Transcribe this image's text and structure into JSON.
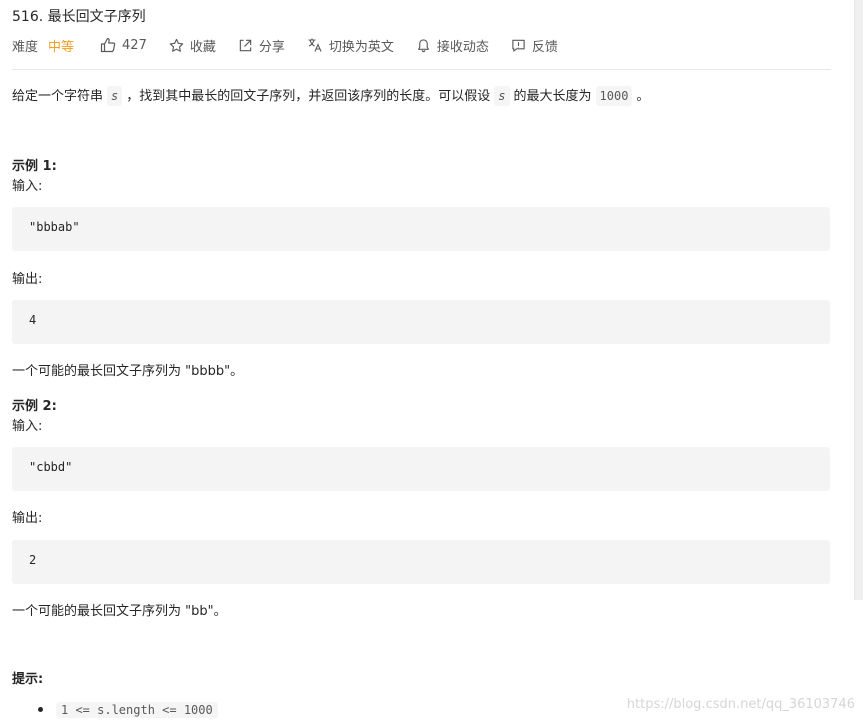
{
  "problem": {
    "title": "516. 最长回文子序列",
    "difficulty_label": "难度",
    "difficulty_value": "中等"
  },
  "actions": {
    "like_count": "427",
    "favorite": "收藏",
    "share": "分享",
    "switch_lang": "切换为英文",
    "subscribe": "接收动态",
    "feedback": "反馈"
  },
  "description": {
    "p1": "给定一个字符串",
    "var_s": "s",
    "p2": "，找到其中最长的回文子序列，并返回该序列的长度。可以假设",
    "p3": "的最大长度为",
    "max_len": "1000",
    "p4": "。"
  },
  "example1": {
    "heading": "示例 1:",
    "input_label": "输入:",
    "input": "\"bbbab\"",
    "output_label": "输出:",
    "output": "4",
    "explain": "一个可能的最长回文子序列为 \"bbbb\"。"
  },
  "example2": {
    "heading": "示例 2:",
    "input_label": "输入:",
    "input": "\"cbbd\"",
    "output_label": "输出:",
    "output": "2",
    "explain": "一个可能的最长回文子序列为 \"bb\"。"
  },
  "hints": {
    "heading": "提示:",
    "items": [
      "1 <= s.length <= 1000"
    ]
  },
  "watermark": "https://blog.csdn.net/qq_36103746",
  "colors": {
    "medium": "#f0a020",
    "code_bg": "#f4f4f4",
    "text": "#262626"
  }
}
